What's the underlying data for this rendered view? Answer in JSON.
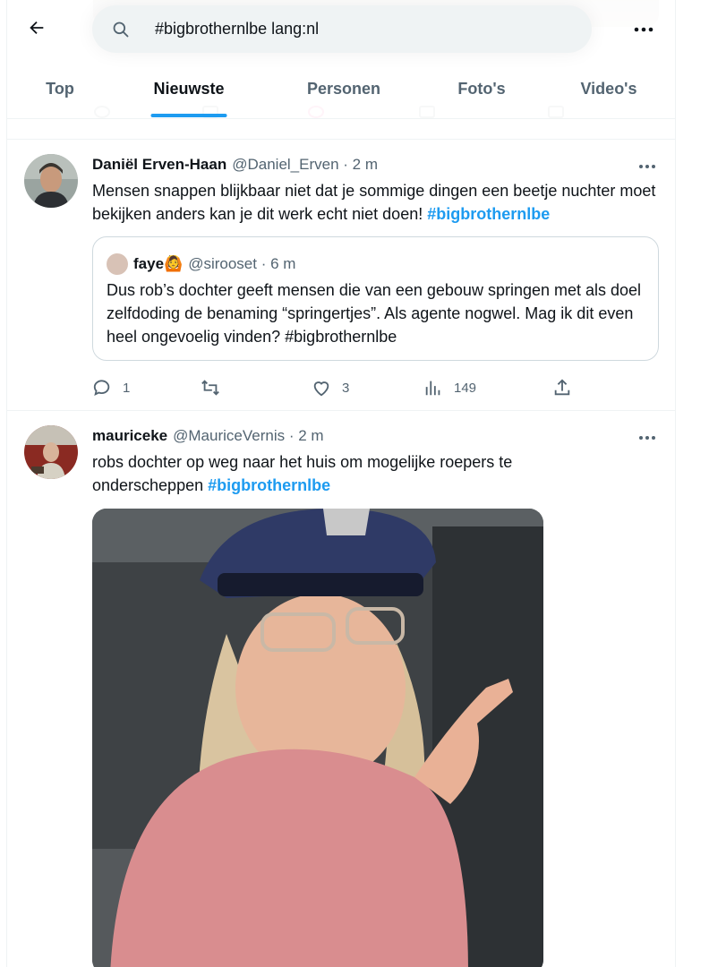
{
  "search": {
    "query": "#bigbrothernlbe lang:nl"
  },
  "tabs": [
    {
      "label": "Top"
    },
    {
      "label": "Nieuwste"
    },
    {
      "label": "Personen"
    },
    {
      "label": "Foto's"
    },
    {
      "label": "Video's"
    }
  ],
  "tweets": [
    {
      "name": "Daniël Erven-Haan",
      "meta": "@Daniel_Erven · 2 m",
      "text": "Mensen snappen blijkbaar niet dat je sommige dingen een beetje nuchter moet bekijken anders kan je dit werk echt niet doen!",
      "hashtag": "#bigbrothernlbe",
      "quote": {
        "name": "faye🙆",
        "meta": "@sirooset · 6 m",
        "text": "Dus rob’s dochter geeft mensen die van een gebouw springen met als doel zelfdoding de benaming “springertjes”. Als agente nogwel. Mag ik dit even heel ongevoelig vinden? #bigbrothernlbe"
      },
      "replies": "1",
      "retweets": "",
      "likes": "3",
      "views": "149"
    },
    {
      "name": "mauriceke",
      "meta": "@MauriceVernis · 2 m",
      "text": "robs dochter op weg naar het huis om mogelijke roepers te onderscheppen",
      "hashtag": "#bigbrothernlbe"
    }
  ],
  "colors": {
    "accent": "#1d9bf0",
    "text": "#0f1419",
    "muted": "#536471",
    "border": "#eff3f4"
  },
  "icons": [
    "back-arrow-icon",
    "search-icon",
    "more-icon",
    "reply-icon",
    "retweet-icon",
    "like-icon",
    "views-icon",
    "share-icon"
  ]
}
